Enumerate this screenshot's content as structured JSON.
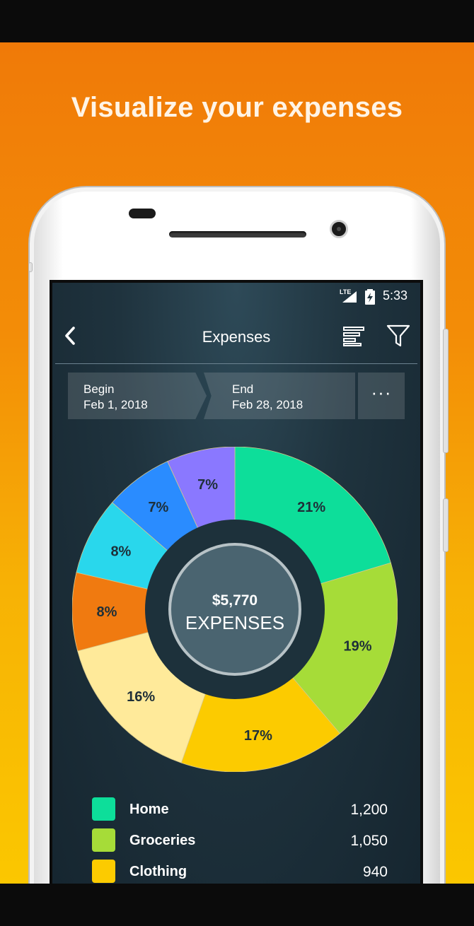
{
  "promo": {
    "title": "Visualize your expenses"
  },
  "status_bar": {
    "network": "LTE",
    "time": "5:33"
  },
  "toolbar": {
    "title": "Expenses",
    "back_icon": "chevron-left-icon",
    "sort_icon": "sort-bars-icon",
    "filter_icon": "funnel-icon"
  },
  "date_range": {
    "begin_label": "Begin",
    "begin_value": "Feb 1, 2018",
    "end_label": "End",
    "end_value": "Feb 28, 2018",
    "more_label": "···"
  },
  "summary": {
    "total": "$5,770",
    "label": "EXPENSES"
  },
  "colors": {
    "slices": [
      "#0dde9a",
      "#a6dc38",
      "#fccb00",
      "#ffea9a",
      "#f07a10",
      "#29d7ec",
      "#2a8cff",
      "#8a78ff"
    ],
    "slice_border": "#d7c88a",
    "hole": "#1d313b",
    "center_fill": "#4a6470",
    "center_ring": "#b7c2c6",
    "label_text": "#1e2f38"
  },
  "chart_data": {
    "type": "pie",
    "donut": true,
    "values": [
      21,
      19,
      17,
      16,
      8,
      8,
      7,
      7
    ],
    "labels": [
      "21%",
      "19%",
      "17%",
      "16%",
      "8%",
      "8%",
      "7%",
      "7%"
    ]
  },
  "legend": [
    {
      "label": "Home",
      "value": "1,200",
      "color": "#0dde9a"
    },
    {
      "label": "Groceries",
      "value": "1,050",
      "color": "#a6dc38"
    },
    {
      "label": "Clothing",
      "value": "940",
      "color": "#fccb00"
    }
  ]
}
